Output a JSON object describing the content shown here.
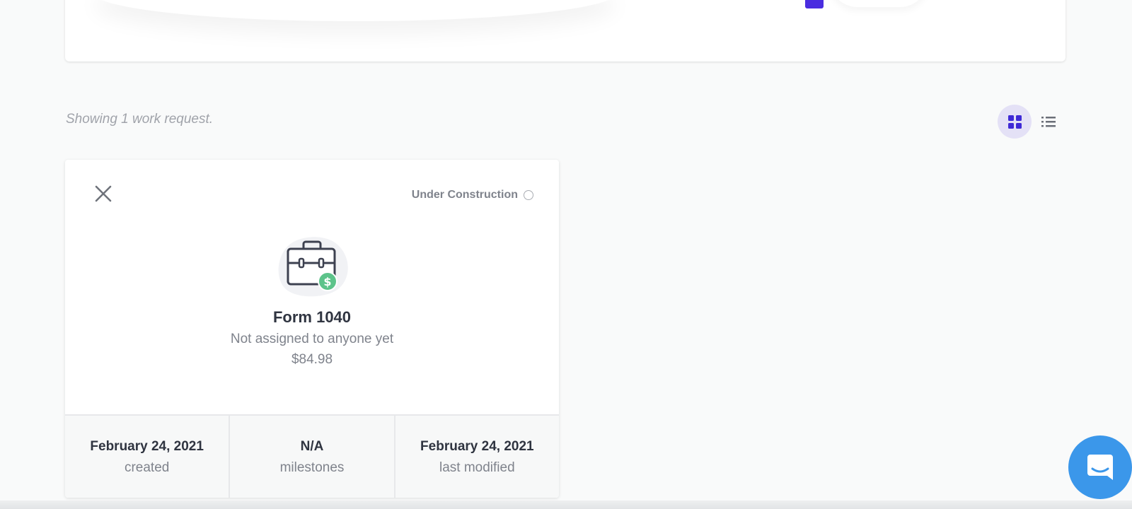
{
  "list": {
    "showing_text": "Showing 1 work request."
  },
  "view_toggle": {
    "active": "grid",
    "options": [
      "grid",
      "list"
    ]
  },
  "card": {
    "status_label": "Under Construction",
    "title": "Form 1040",
    "assignee": "Not assigned to anyone yet",
    "price": "$84.98",
    "footer": [
      {
        "value": "February 24, 2021",
        "label": "created"
      },
      {
        "value": "N/A",
        "label": "milestones"
      },
      {
        "value": "February 24, 2021",
        "label": "last modified"
      }
    ]
  },
  "icons": {
    "close": "close-icon",
    "briefcase": "briefcase-dollar-icon",
    "grid_view": "grid-view-icon",
    "list_view": "list-view-icon",
    "chat": "chat-icon"
  },
  "colors": {
    "accent": "#3f2ad6",
    "accent_bg": "#e4e1f6",
    "chat": "#3b97ea",
    "money_badge": "#5cc38a"
  }
}
